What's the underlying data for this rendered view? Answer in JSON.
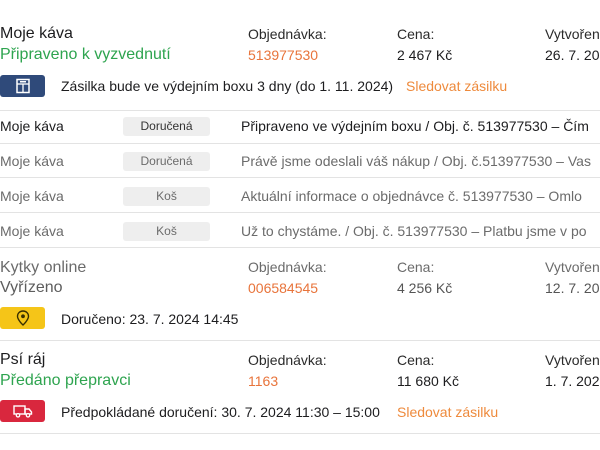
{
  "orders": [
    {
      "shop": "Moje káva",
      "status": "Připraveno k vyzvednutí",
      "order_label": "Objednávka:",
      "order_no": "513977530",
      "price_label": "Cena:",
      "price": "2 467 Kč",
      "created_label": "Vytvořen",
      "created": "26. 7. 20",
      "note": "Zásilka bude ve výdejním boxu 3 dny (do 1. 11. 2024)",
      "link": "Sledovat zásilku",
      "icon": "parcel-box-icon",
      "icon_color": "#2f4a7a"
    },
    {
      "shop": "Kytky online",
      "status": "Vyřízeno",
      "order_label": "Objednávka:",
      "order_no": "006584545",
      "price_label": "Cena:",
      "price": "4 256 Kč",
      "created_label": "Vytvořen",
      "created": "12. 7. 20",
      "note": "Doručeno: 23. 7. 2024 14:45",
      "icon": "location-pin-icon",
      "icon_color": "#f5c518"
    },
    {
      "shop": "Psí ráj",
      "status": "Předáno přepravci",
      "order_label": "Objednávka:",
      "order_no": "1163",
      "price_label": "Cena:",
      "price": "11 680 Kč",
      "created_label": "Vytvořen",
      "created": "1. 7. 202",
      "note": "Předpokládané doručení: 30. 7. 2024 11:30 – 15:00",
      "link": "Sledovat zásilku",
      "icon": "delivery-truck-icon",
      "icon_color": "#d9273e"
    }
  ],
  "notifications": [
    {
      "shop": "Moje káva",
      "badge": "Doručená",
      "text": "Připraveno ve výdejním boxu / Obj. č. 513977530  –  Čím"
    },
    {
      "shop": "Moje káva",
      "badge": "Doručená",
      "text": "Právě jsme odeslali váš nákup / Obj. č.513977530  –  Vas"
    },
    {
      "shop": "Moje káva",
      "badge": "Koš",
      "text": "Aktuální informace o objednávce č. 513977530  –  Omlo"
    },
    {
      "shop": "Moje káva",
      "badge": "Koš",
      "text": "Už to chystáme. / Obj. č. 513977530  –  Platbu jsme v po"
    }
  ],
  "colors": {
    "accent_orange": "#e8743b",
    "status_green": "#2ea44f"
  }
}
